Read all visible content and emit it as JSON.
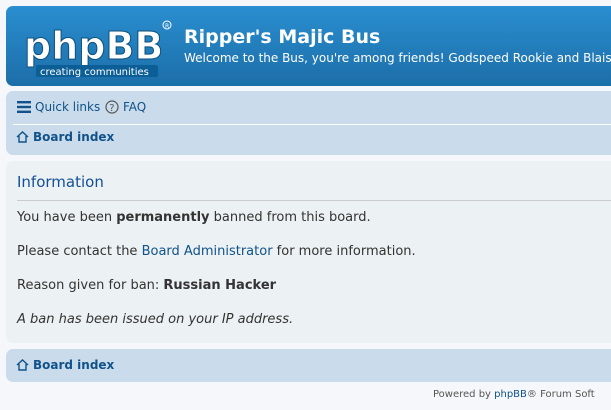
{
  "header": {
    "logo_text": "phpBB",
    "logo_tagline": "creating communities",
    "site_title": "Ripper's Majic Bus",
    "site_description": "Welcome to the Bus, you're among friends! Godspeed Rookie and Blaise!"
  },
  "navbar": {
    "quick_links": "Quick links",
    "faq": "FAQ",
    "breadcrumb": "Board index"
  },
  "message": {
    "title": "Information",
    "line1_pre": "You have been ",
    "line1_bold": "permanently",
    "line1_post": " banned from this board.",
    "line2_pre": "Please contact the ",
    "line2_link": "Board Administrator",
    "line2_post": " for more information.",
    "line3_pre": "Reason given for ban: ",
    "line3_bold": "Russian Hacker",
    "line4": "A ban has been issued on your IP address."
  },
  "footer": {
    "breadcrumb": "Board index",
    "powered_pre": "Powered by ",
    "powered_link": "phpBB",
    "powered_post": "® Forum Soft"
  },
  "colors": {
    "header_blue": "#1c6ea8",
    "nav_bg": "#cadceb",
    "panel_bg": "#ecf1f3",
    "link": "#105289"
  }
}
